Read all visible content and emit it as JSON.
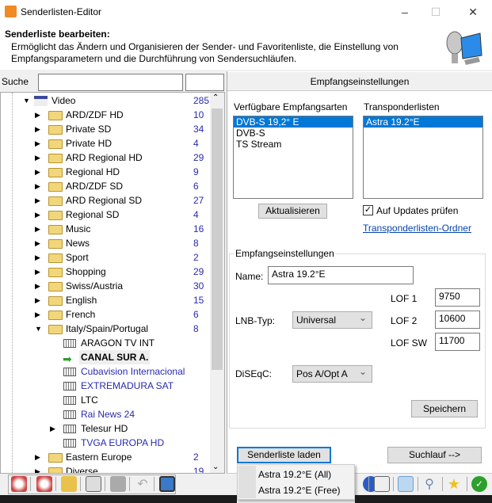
{
  "window": {
    "title": "Senderlisten-Editor",
    "minimize": "–",
    "maximize": "☐",
    "close": "✕"
  },
  "header": {
    "title": "Senderliste bearbeiten:",
    "description": "Ermöglicht das Ändern und Organisieren der Sender- und Favoritenliste, die Einstellung von Empfangsparametern und die Durchführung von Sendersuchläufen."
  },
  "search": {
    "label": "Suche",
    "value": "",
    "value2": ""
  },
  "tree": {
    "root": {
      "label": "Video",
      "count": "285"
    },
    "folders": [
      {
        "label": "ARD/ZDF HD",
        "count": "10"
      },
      {
        "label": "Private SD",
        "count": "34"
      },
      {
        "label": "Private HD",
        "count": "4"
      },
      {
        "label": "ARD Regional HD",
        "count": "29"
      },
      {
        "label": "Regional HD",
        "count": "9"
      },
      {
        "label": "ARD/ZDF SD",
        "count": "6"
      },
      {
        "label": "ARD Regional SD",
        "count": "27"
      },
      {
        "label": "Regional SD",
        "count": "4"
      },
      {
        "label": "Music",
        "count": "16"
      },
      {
        "label": "News",
        "count": "8"
      },
      {
        "label": "Sport",
        "count": "2"
      },
      {
        "label": "Shopping",
        "count": "29"
      },
      {
        "label": "Swiss/Austria",
        "count": "30"
      },
      {
        "label": "English",
        "count": "15"
      },
      {
        "label": "French",
        "count": "6"
      },
      {
        "label": "Italy/Spain/Portugal",
        "count": "8"
      }
    ],
    "channels": [
      {
        "label": "ARAGON TV INT",
        "color": "#000000"
      },
      {
        "label": "CANAL SUR A.",
        "color": "#000000",
        "selected": true
      },
      {
        "label": "Cubavision Internacional",
        "color": "#2a2ab0"
      },
      {
        "label": "EXTREMADURA SAT",
        "color": "#2a2ab0"
      },
      {
        "label": "LTC",
        "color": "#000000"
      },
      {
        "label": "Rai News 24",
        "color": "#2a2ab0"
      },
      {
        "label": "Telesur HD",
        "color": "#000000"
      },
      {
        "label": "TVGA EUROPA HD",
        "color": "#2a2ab0"
      }
    ],
    "folders_after": [
      {
        "label": "Eastern Europe",
        "count": "2"
      },
      {
        "label": "Diverse",
        "count": "19"
      }
    ]
  },
  "right": {
    "tab_title": "Empfangseinstellungen",
    "reception_types_label": "Verfügbare Empfangsarten",
    "reception_types": [
      "DVB-S 19,2° E",
      "DVB-S",
      "TS Stream"
    ],
    "transponder_label": "Transponderlisten",
    "transponders": [
      "Astra 19.2°E"
    ],
    "refresh_button": "Aktualisieren",
    "check_updates": {
      "label": "Auf Updates prüfen",
      "checked": true
    },
    "folder_link": "Transponderlisten-Ordner",
    "group": {
      "title": "Empfangseinstellungen",
      "name_label": "Name:",
      "name_value": "Astra 19.2°E",
      "lnb_label": "LNB-Typ:",
      "lnb_value": "Universal",
      "lof1_label": "LOF 1",
      "lof1": "9750",
      "lof2_label": "LOF 2",
      "lof2": "10600",
      "lofsw_label": "LOF SW",
      "lofsw": "11700",
      "diseqc_label": "DiSEqC:",
      "diseqc_value": "Pos A/Opt A",
      "save_button": "Speichern"
    },
    "load_button": "Senderliste laden",
    "scan_button": "Suchlauf -->",
    "load_menu": [
      "Astra 19.2°E (All)",
      "Astra 19.2°E (Free)"
    ]
  }
}
